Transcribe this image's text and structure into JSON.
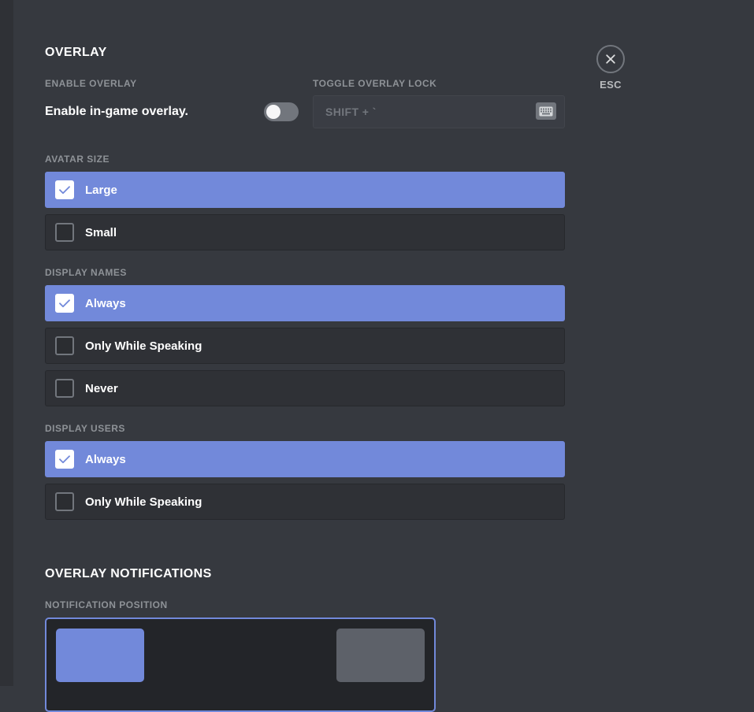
{
  "window": {
    "close": {
      "label": "ESC",
      "icon": "close-icon"
    }
  },
  "overlay_section": {
    "title": "OVERLAY",
    "enable_overlay": {
      "label": "ENABLE OVERLAY",
      "description": "Enable in-game overlay.",
      "toggle_state": "off"
    },
    "toggle_overlay_lock": {
      "label": "TOGGLE OVERLAY LOCK",
      "keybind_value": "SHIFT + `",
      "icon": "keyboard-icon"
    },
    "avatar_size": {
      "label": "AVATAR SIZE",
      "options": [
        {
          "label": "Large",
          "selected": true
        },
        {
          "label": "Small",
          "selected": false
        }
      ]
    },
    "display_names": {
      "label": "DISPLAY NAMES",
      "options": [
        {
          "label": "Always",
          "selected": true
        },
        {
          "label": "Only While Speaking",
          "selected": false
        },
        {
          "label": "Never",
          "selected": false
        }
      ]
    },
    "display_users": {
      "label": "DISPLAY USERS",
      "options": [
        {
          "label": "Always",
          "selected": true
        },
        {
          "label": "Only While Speaking",
          "selected": false
        }
      ]
    }
  },
  "notifications_section": {
    "title": "OVERLAY NOTIFICATIONS",
    "notification_position": {
      "label": "NOTIFICATION POSITION",
      "cells": [
        {
          "position": "top-left",
          "selected": true
        },
        {
          "position": "top-right",
          "selected": false
        }
      ]
    }
  },
  "colors": {
    "background": "#36393f",
    "accent": "#7289da",
    "row_unselected": "#2f3136",
    "label_muted": "#8e9297",
    "toggle_off": "#72767d"
  }
}
